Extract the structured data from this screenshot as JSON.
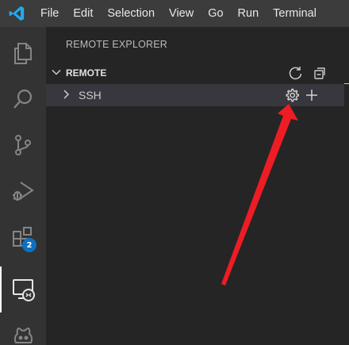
{
  "app": {
    "logo_icon": "vscode-logo-icon"
  },
  "menu": {
    "items": [
      "File",
      "Edit",
      "Selection",
      "View",
      "Go",
      "Run",
      "Terminal"
    ]
  },
  "activity_bar": {
    "items": [
      {
        "name": "explorer",
        "icon": "files-icon"
      },
      {
        "name": "search",
        "icon": "search-icon"
      },
      {
        "name": "source-control",
        "icon": "source-control-icon"
      },
      {
        "name": "run-and-debug",
        "icon": "debug-icon"
      },
      {
        "name": "extensions",
        "icon": "extensions-icon",
        "badge": "2"
      },
      {
        "name": "remote-explorer",
        "icon": "remote-explorer-icon",
        "active": true
      },
      {
        "name": "github",
        "icon": "github-icon"
      }
    ]
  },
  "sidebar": {
    "title": "REMOTE EXPLORER",
    "section": {
      "label": "REMOTE",
      "expanded": true,
      "actions": [
        "refresh-icon",
        "collapse-all-icon"
      ]
    },
    "tree": [
      {
        "label": "SSH",
        "expanded": false,
        "selected": true,
        "actions": [
          "gear-icon",
          "add-icon"
        ]
      }
    ]
  },
  "colors": {
    "menubar": "#3c3c3c",
    "activitybar": "#333333",
    "sidebar": "#252526",
    "selected_row": "#37373d",
    "badge": "#0e70c0",
    "annotation_arrow": "#ee1c25",
    "vscode_blue": "#23a9f2"
  }
}
